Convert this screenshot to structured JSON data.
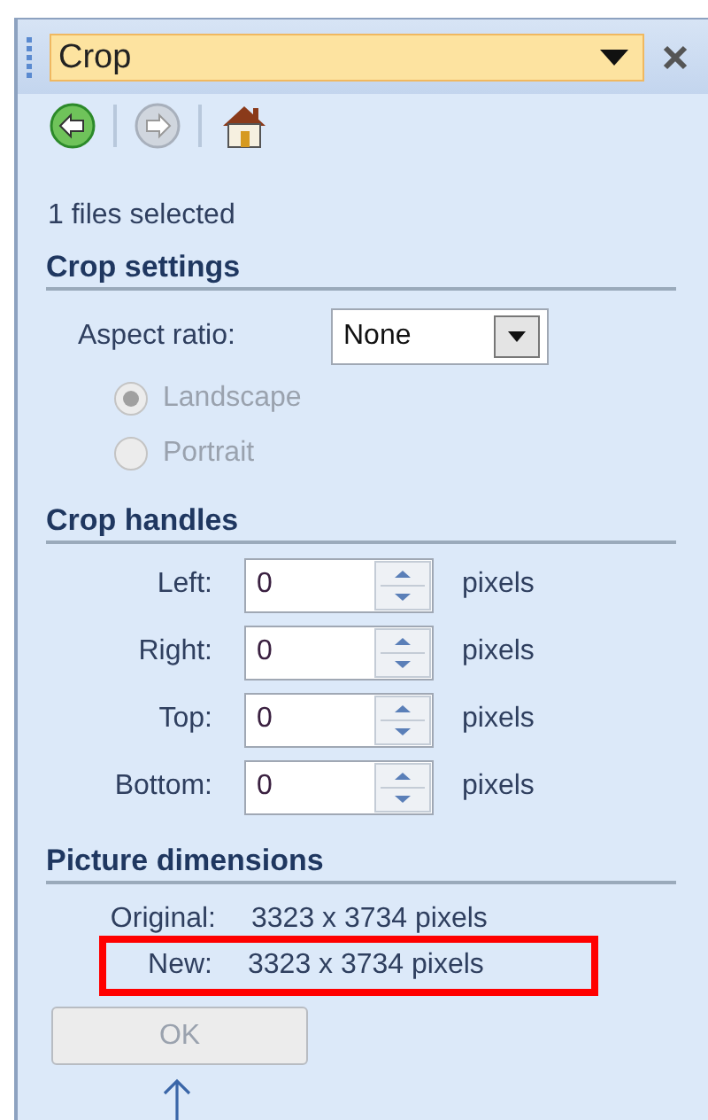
{
  "panel": {
    "title": "Crop"
  },
  "toolbar": [
    {
      "kind": "back",
      "disabled": false
    },
    {
      "kind": "forward",
      "disabled": true
    },
    {
      "kind": "home",
      "disabled": false
    }
  ],
  "selection_info": "1 files selected",
  "crop_settings": {
    "heading": "Crop settings",
    "aspect_label": "Aspect ratio:",
    "aspect_value": "None",
    "orientations": [
      {
        "label": "Landscape",
        "selected": true,
        "disabled": true
      },
      {
        "label": "Portrait",
        "selected": false,
        "disabled": true
      }
    ]
  },
  "crop_handles": {
    "heading": "Crop handles",
    "rows": [
      {
        "label": "Left:",
        "value": "0",
        "unit": "pixels"
      },
      {
        "label": "Right:",
        "value": "0",
        "unit": "pixels"
      },
      {
        "label": "Top:",
        "value": "0",
        "unit": "pixels"
      },
      {
        "label": "Bottom:",
        "value": "0",
        "unit": "pixels"
      }
    ]
  },
  "picture_dimensions": {
    "heading": "Picture dimensions",
    "rows": [
      {
        "label": "Original:",
        "value": "3323 x 3734 pixels",
        "highlighted": false
      },
      {
        "label": "New:",
        "value": "3323 x 3734 pixels",
        "highlighted": true
      }
    ]
  },
  "ok_button": {
    "label": "OK",
    "disabled": true
  }
}
